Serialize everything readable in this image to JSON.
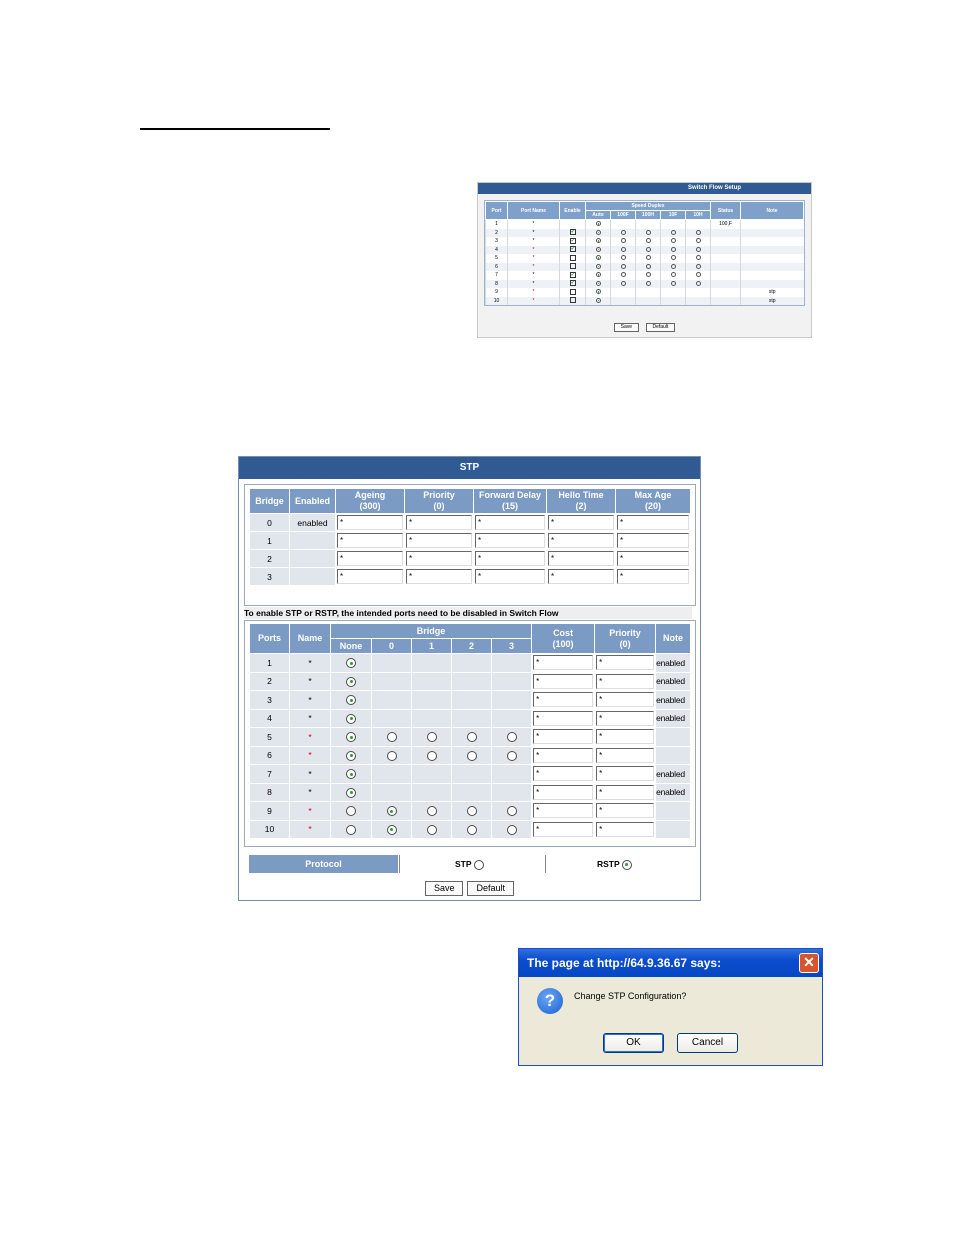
{
  "switch_flow": {
    "title": "Switch Flow Setup",
    "headers": {
      "port": "Port",
      "port_name": "Port Name",
      "enable": "Enable",
      "speed_duplex": "Speed Duplex",
      "auto": "Auto",
      "h100f": "100F",
      "h100h": "100H",
      "h10f": "10F",
      "h10h": "10H",
      "status": "Status",
      "note": "Note"
    },
    "rows": [
      {
        "port": "1",
        "name": "*",
        "red": false,
        "check": "none",
        "full": false,
        "status": "100,F",
        "note": ""
      },
      {
        "port": "2",
        "name": "*",
        "red": false,
        "check": "checked",
        "full": true,
        "status": "",
        "note": ""
      },
      {
        "port": "3",
        "name": "*",
        "red": false,
        "check": "checked",
        "full": true,
        "status": "",
        "note": ""
      },
      {
        "port": "4",
        "name": "*",
        "red": true,
        "check": "checked",
        "full": true,
        "status": "",
        "note": ""
      },
      {
        "port": "5",
        "name": "*",
        "red": true,
        "check": "unchecked",
        "full": true,
        "status": "",
        "note": ""
      },
      {
        "port": "6",
        "name": "*",
        "red": true,
        "check": "unchecked",
        "full": true,
        "status": "",
        "note": ""
      },
      {
        "port": "7",
        "name": "*",
        "red": false,
        "check": "checked",
        "full": true,
        "status": "",
        "note": ""
      },
      {
        "port": "8",
        "name": "*",
        "red": false,
        "check": "checked",
        "full": true,
        "status": "",
        "note": ""
      },
      {
        "port": "9",
        "name": "*",
        "red": true,
        "check": "unchecked",
        "full": false,
        "status": "",
        "note": "stp"
      },
      {
        "port": "10",
        "name": "*",
        "red": true,
        "check": "unchecked",
        "full": false,
        "status": "",
        "note": "stp"
      }
    ],
    "save": "Save",
    "default": "Default"
  },
  "stp": {
    "title": "STP",
    "bridge_headers": {
      "bridge": "Bridge",
      "enabled": "Enabled",
      "ageing": "Ageing",
      "ageing_sub": "(300)",
      "priority": "Priority",
      "priority_sub": "(0)",
      "fwd": "Forward Delay",
      "fwd_sub": "(15)",
      "hello": "Hello Time",
      "hello_sub": "(2)",
      "maxage": "Max Age",
      "maxage_sub": "(20)"
    },
    "bridges": [
      {
        "id": "0",
        "enabled": "enabled"
      },
      {
        "id": "1",
        "enabled": ""
      },
      {
        "id": "2",
        "enabled": ""
      },
      {
        "id": "3",
        "enabled": ""
      }
    ],
    "field_value": "*",
    "notice": "To enable STP or RSTP, the intended ports need to be disabled in Switch Flow",
    "port_headers": {
      "ports": "Ports",
      "name": "Name",
      "bridge": "Bridge",
      "none": "None",
      "b0": "0",
      "b1": "1",
      "b2": "2",
      "b3": "3",
      "cost": "Cost",
      "cost_sub": "(100)",
      "priority": "Priority",
      "priority_sub": "(0)",
      "note": "Note"
    },
    "ports": [
      {
        "port": "1",
        "name": "*",
        "red": false,
        "sel": "none",
        "full": false,
        "note": "enabled"
      },
      {
        "port": "2",
        "name": "*",
        "red": false,
        "sel": "none",
        "full": false,
        "note": "enabled"
      },
      {
        "port": "3",
        "name": "*",
        "red": false,
        "sel": "none",
        "full": false,
        "note": "enabled"
      },
      {
        "port": "4",
        "name": "*",
        "red": false,
        "sel": "none",
        "full": false,
        "note": "enabled"
      },
      {
        "port": "5",
        "name": "*",
        "red": true,
        "sel": "none",
        "full": true,
        "note": ""
      },
      {
        "port": "6",
        "name": "*",
        "red": true,
        "sel": "none",
        "full": true,
        "note": ""
      },
      {
        "port": "7",
        "name": "*",
        "red": false,
        "sel": "none",
        "full": false,
        "note": "enabled"
      },
      {
        "port": "8",
        "name": "*",
        "red": false,
        "sel": "none",
        "full": false,
        "note": "enabled"
      },
      {
        "port": "9",
        "name": "*",
        "red": true,
        "sel": "0",
        "full": true,
        "note": ""
      },
      {
        "port": "10",
        "name": "*",
        "red": true,
        "sel": "0",
        "full": true,
        "note": ""
      }
    ],
    "protocol_label": "Protocol",
    "stp_option": "STP",
    "rstp_option": "RSTP",
    "protocol_selected": "RSTP",
    "save": "Save",
    "default": "Default"
  },
  "dialog": {
    "title": "The page at http://64.9.36.67 says:",
    "message": "Change STP Configuration?",
    "ok": "OK",
    "cancel": "Cancel",
    "close_glyph": "✕",
    "icon_glyph": "?"
  }
}
